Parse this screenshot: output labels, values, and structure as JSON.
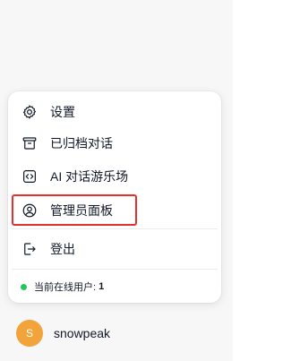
{
  "menu": {
    "items": [
      {
        "label": "设置",
        "icon": "gear-icon"
      },
      {
        "label": "已归档对话",
        "icon": "archive-box-icon"
      },
      {
        "label": "AI 对话游乐场",
        "icon": "code-bracket-square-icon"
      },
      {
        "label": "管理员面板",
        "icon": "user-circle-icon",
        "highlighted": true
      },
      {
        "label": "登出",
        "icon": "logout-icon"
      }
    ],
    "highlight_color": "#e5312c"
  },
  "online_status": {
    "label": "当前在线用户:",
    "count": "1",
    "dot_color": "#22c55e"
  },
  "user": {
    "avatar_initial": "S",
    "avatar_color": "#f2a33a",
    "name": "snowpeak"
  }
}
